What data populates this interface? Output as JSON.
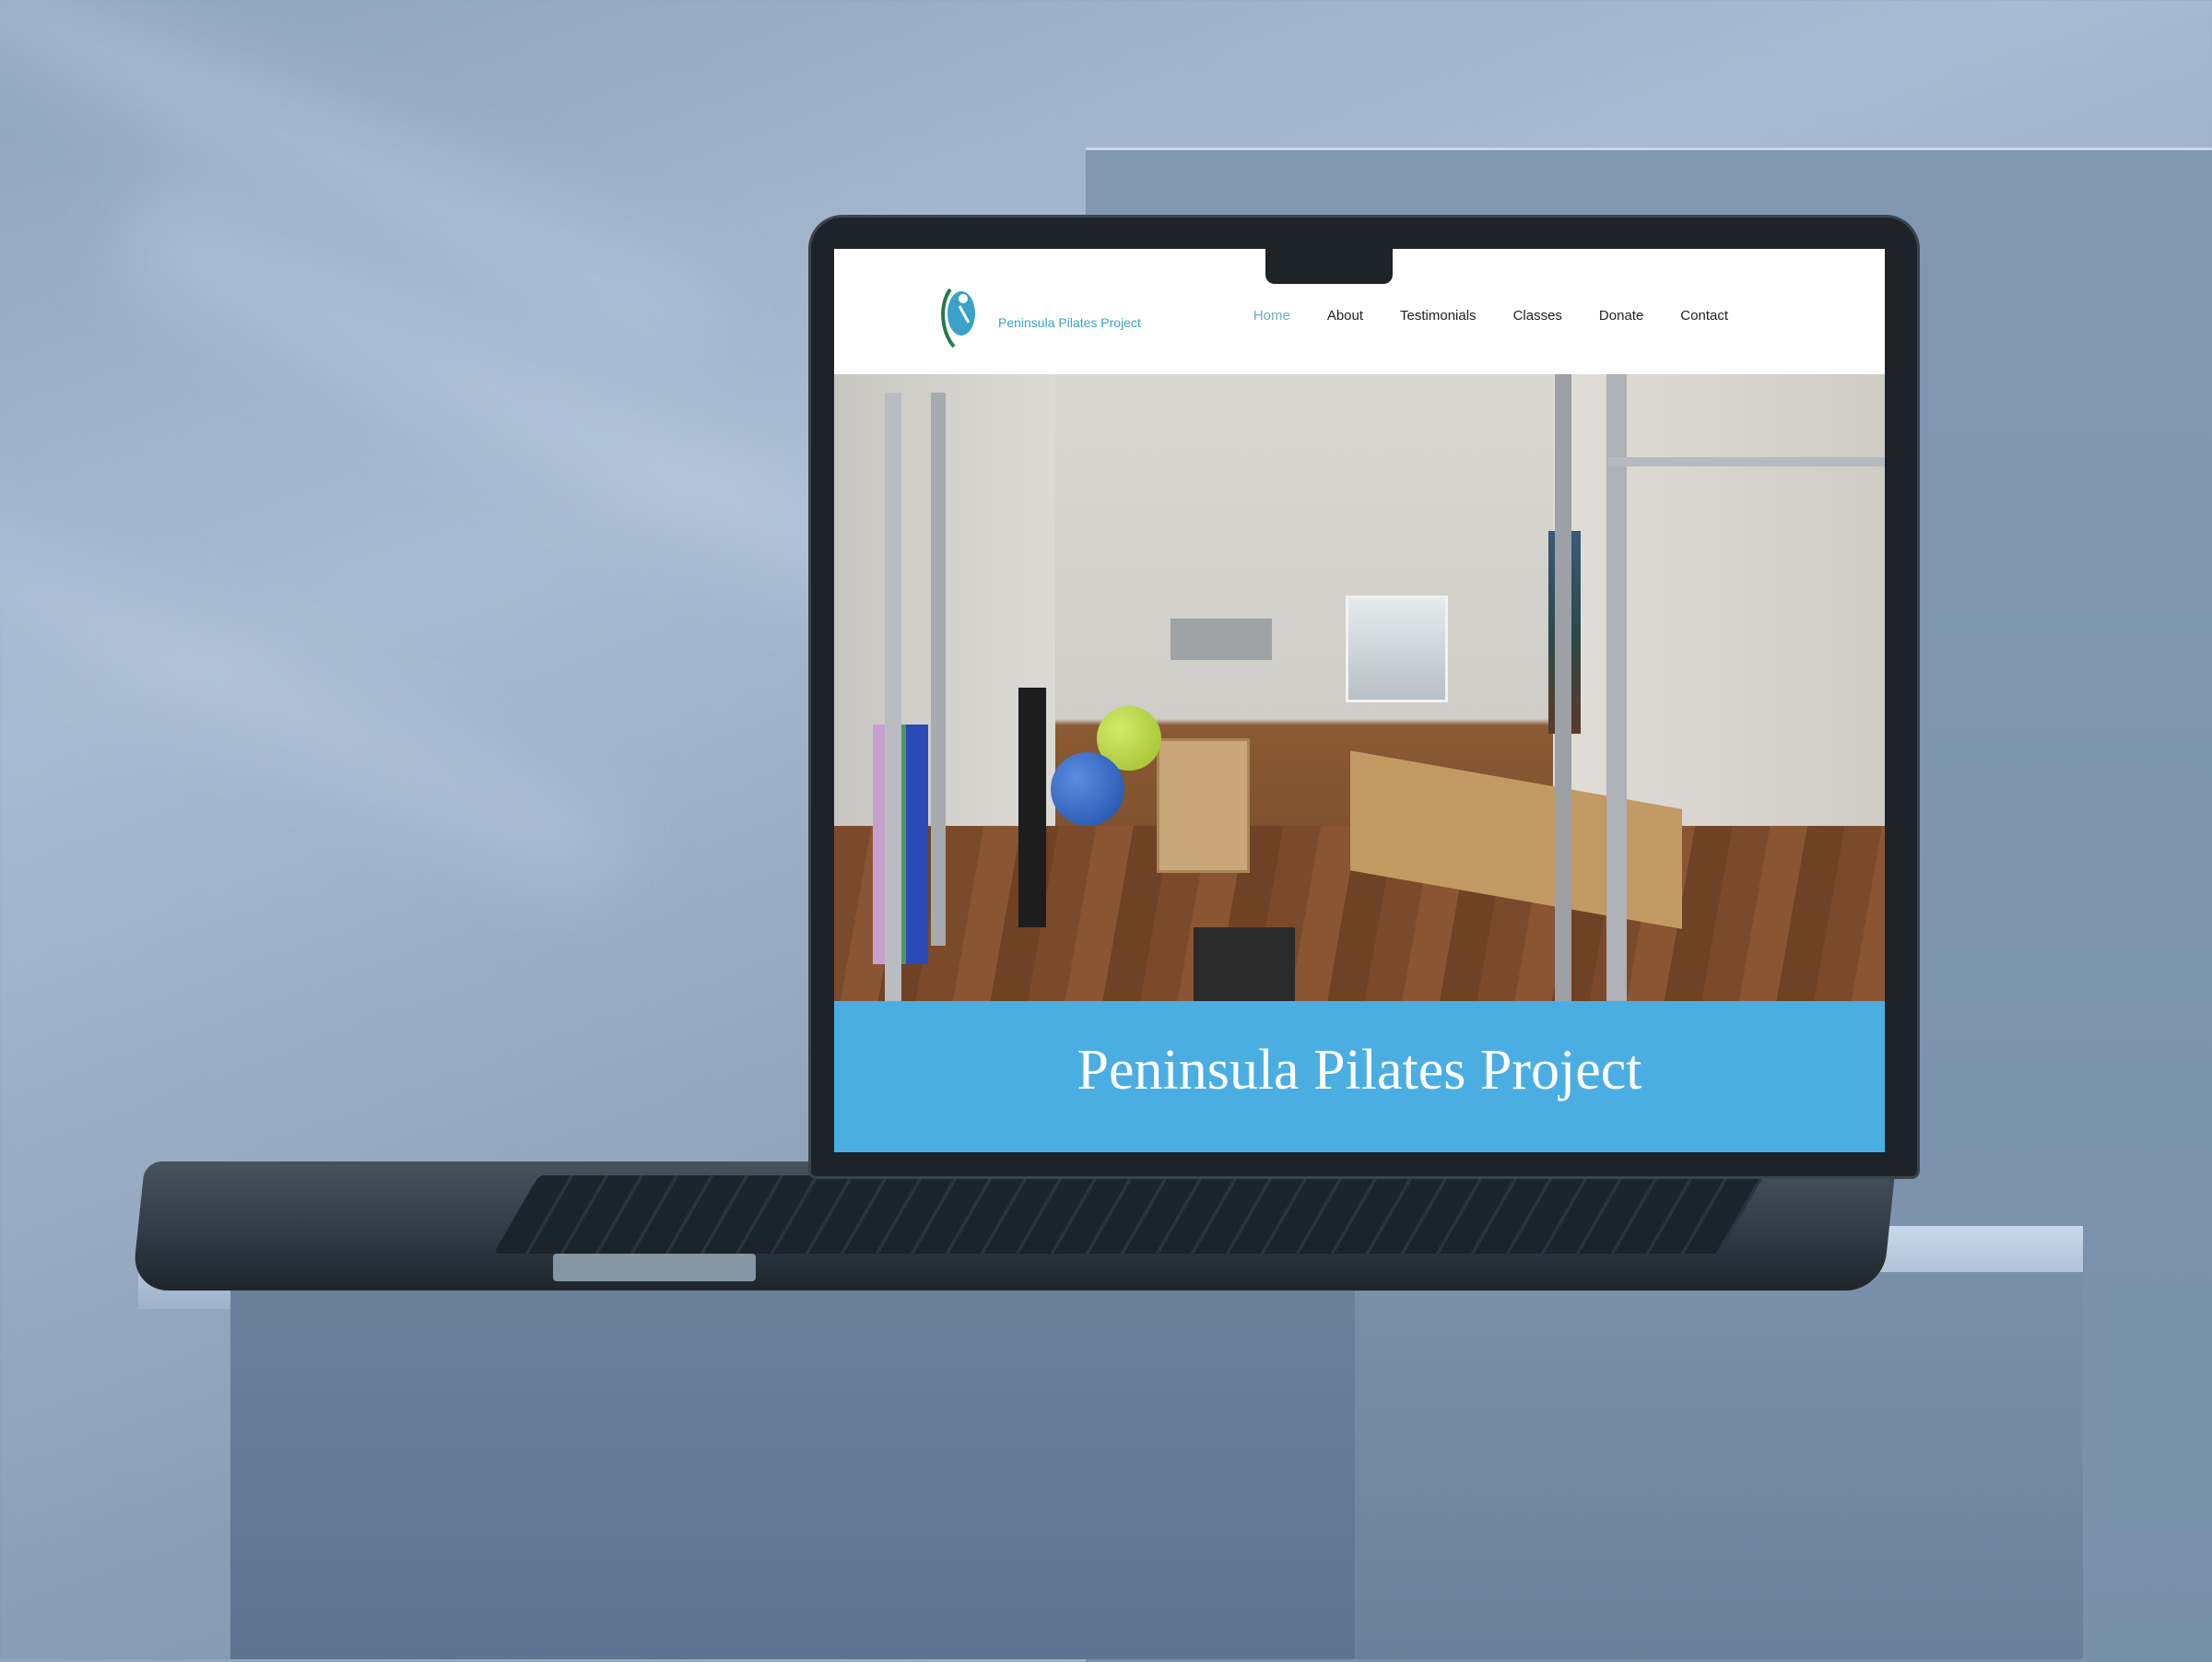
{
  "site": {
    "brand_name": "Peninsula Pilates Project",
    "logo_icon": "pilates-figure-logo-icon"
  },
  "nav": {
    "items": [
      {
        "label": "Home",
        "active": true
      },
      {
        "label": "About",
        "active": false
      },
      {
        "label": "Testimonials",
        "active": false
      },
      {
        "label": "Classes",
        "active": false
      },
      {
        "label": "Donate",
        "active": false
      },
      {
        "label": "Contact",
        "active": false
      }
    ]
  },
  "hero": {
    "image_subject": "pilates studio room with cadillac, reformer and exercise balls"
  },
  "banner": {
    "title": "Peninsula Pilates Project",
    "color": "#4aaee3"
  },
  "colors": {
    "accent": "#4aaee3",
    "nav_active": "#6aaccd",
    "brand_text": "#3aa2c8"
  }
}
